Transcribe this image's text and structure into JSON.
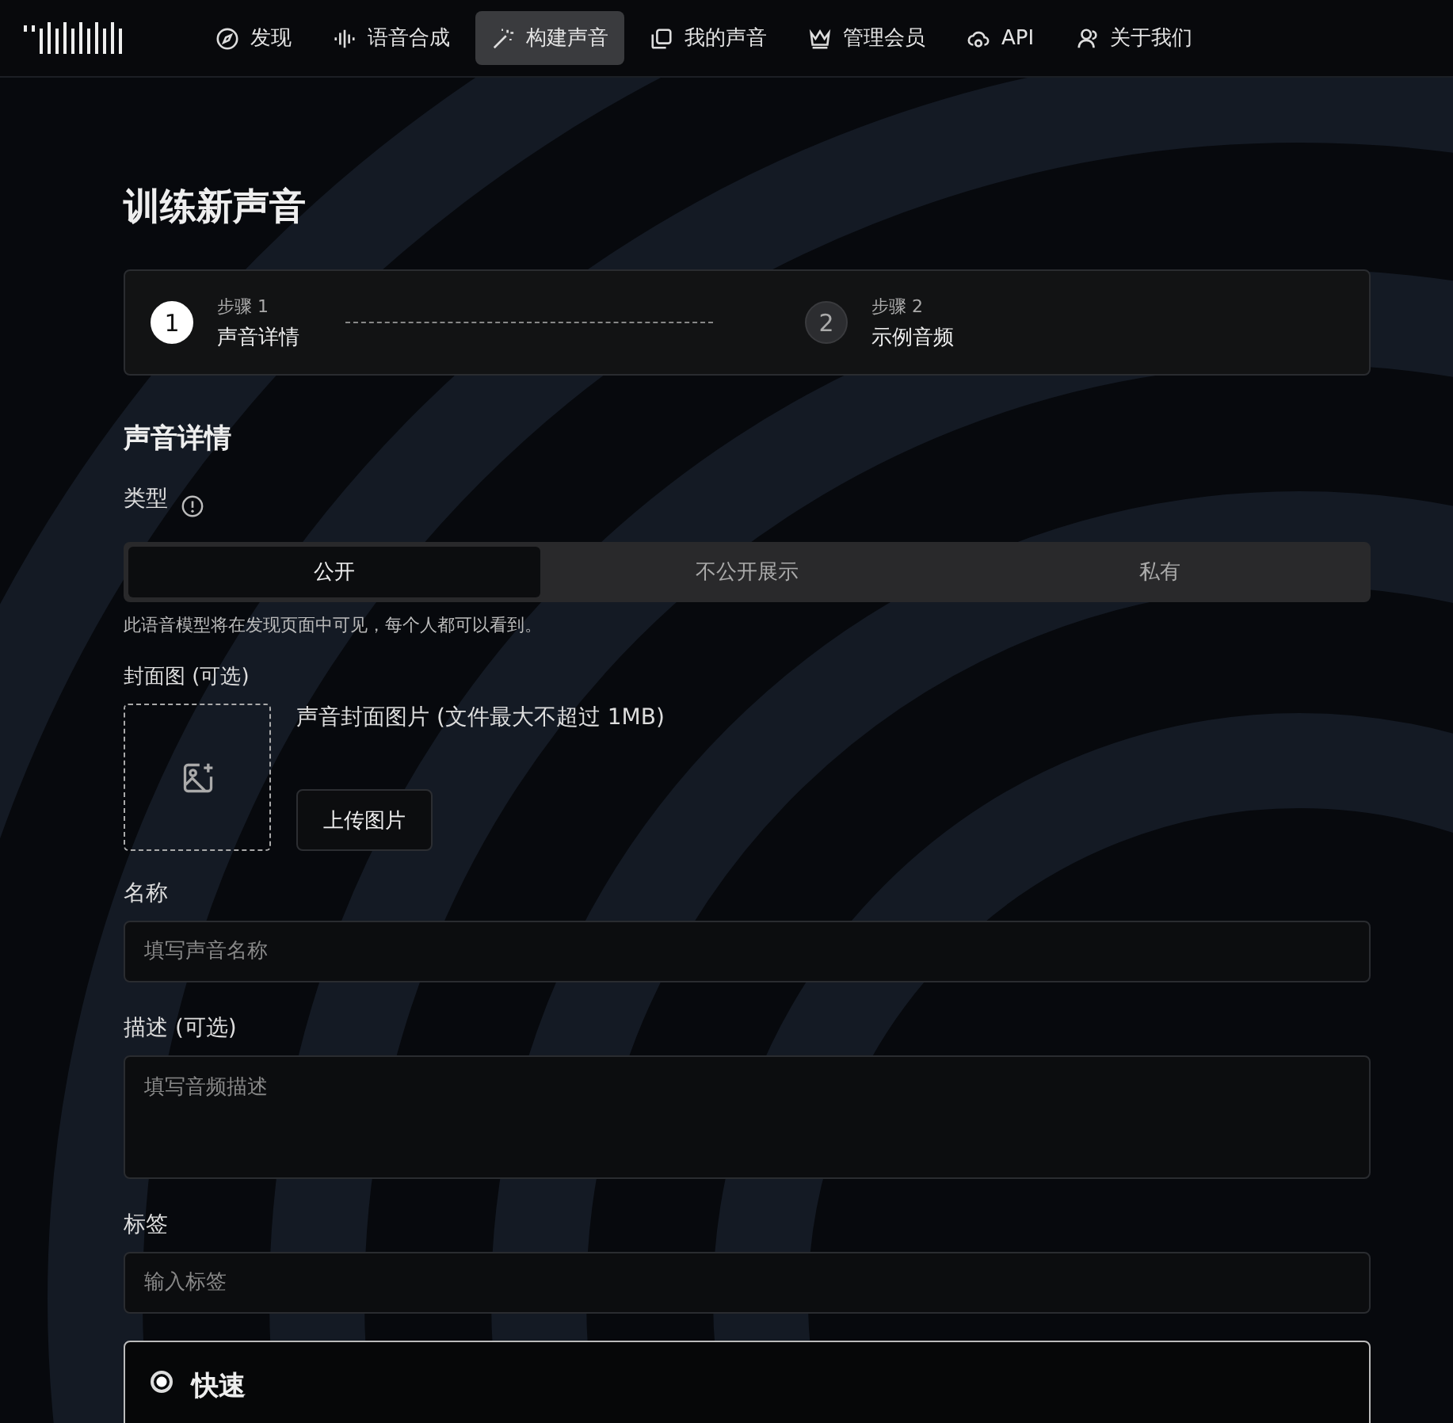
{
  "nav": {
    "items": [
      {
        "label": "发现",
        "selected": false
      },
      {
        "label": "语音合成",
        "selected": false
      },
      {
        "label": "构建声音",
        "selected": true
      },
      {
        "label": "我的声音",
        "selected": false
      },
      {
        "label": "管理会员",
        "selected": false
      },
      {
        "label": "API",
        "selected": false
      },
      {
        "label": "关于我们",
        "selected": false
      }
    ]
  },
  "page_title": "训练新声音",
  "steps": [
    {
      "number": "1",
      "caption": "步骤 1",
      "label": "声音详情",
      "selected": true
    },
    {
      "number": "2",
      "caption": "步骤 2",
      "label": "示例音频",
      "selected": false
    }
  ],
  "section_title": "声音详情",
  "type_field": {
    "label": "类型",
    "options": [
      {
        "label": "公开",
        "selected": true
      },
      {
        "label": "不公开展示",
        "selected": false
      },
      {
        "label": "私有",
        "selected": false
      }
    ],
    "hint": "此语音模型将在发现页面中可见，每个人都可以看到。"
  },
  "cover": {
    "label": "封面图 (可选)",
    "description": "声音封面图片 (文件最大不超过 1MB)",
    "button": "上传图片"
  },
  "name_field": {
    "label": "名称",
    "placeholder": "填写声音名称"
  },
  "description_field": {
    "label": "描述 (可选)",
    "placeholder": "填写音频描述"
  },
  "tags_field": {
    "label": "标签",
    "placeholder": "输入标签"
  },
  "mode": {
    "label": "快速",
    "selected": true
  }
}
